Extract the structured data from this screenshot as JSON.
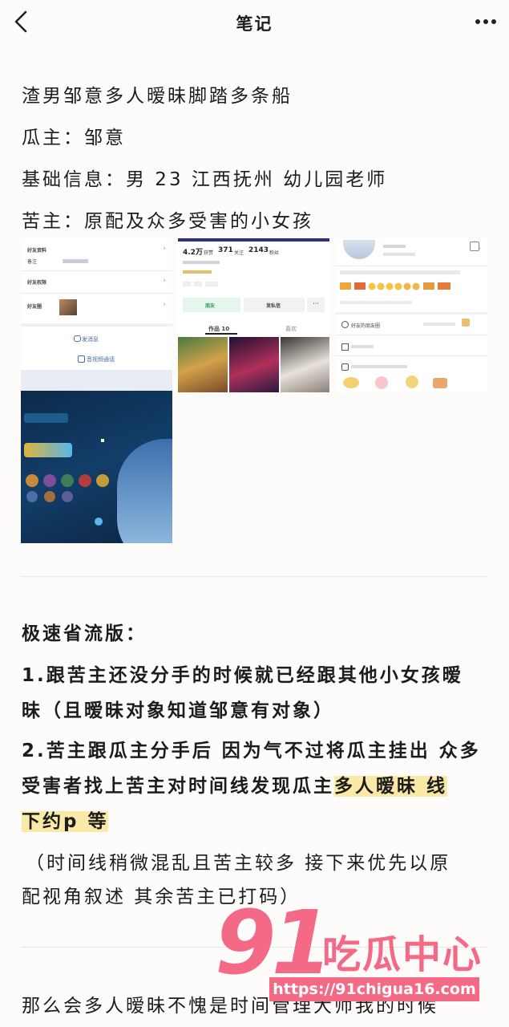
{
  "header": {
    "title": "笔记"
  },
  "post": {
    "line1": "渣男邹意多人暧昧脚踏多条船",
    "line2": "瓜主：邹意",
    "line3": "基础信息：男 23 江西抚州 幼儿园老师",
    "line4": "苦主：原配及众多受害的小女孩"
  },
  "screenshots": {
    "p1": {
      "item1": "好友资料",
      "item1_sub": "备注",
      "item2": "好友权限",
      "item3": "好友圈",
      "send_msg": "发消息",
      "call": "音视频通话"
    },
    "p2": {
      "likes": "4.2万",
      "likes_label": "获赞",
      "follow": "371",
      "follow_label": "关注",
      "fans": "2143",
      "fans_label": "粉丝",
      "btn_friend": "朋友",
      "btn_msg": "发私信",
      "tab_works": "作品 10",
      "tab_likes": "喜欢"
    },
    "p3": {
      "circle": "好友的朋友圈"
    }
  },
  "section": {
    "heading": "极速省流版：",
    "p1_line1": "1.跟苦主还没分手的时候就已经跟其他小女孩暧",
    "p1_line2": "昧（且暧昧对象知道邹意有对象）",
    "p2_line1": "2.苦主跟瓜主分手后 因为气不过将瓜主挂出 众多",
    "p2_line2_a": "受害者找上苦主对时间线发现瓜主",
    "p2_line2_hl": "多人暧昧 线",
    "p2_line3": "下约p 等",
    "note_line1": "（时间线稍微混乱且苦主较多 接下来优先以原",
    "note_line2": "配视角叙述 其余苦主已打码）"
  },
  "bottom": {
    "line": "那么会多人暧昧不愧是时间管理大师我的时候"
  },
  "watermark": {
    "number": "91",
    "brand": "吃瓜中心",
    "url": "https://91chigua16.com"
  },
  "colors": {
    "highlight": "#fbe9a8",
    "watermark": "#f46a86",
    "background": "#fdfcfa"
  }
}
